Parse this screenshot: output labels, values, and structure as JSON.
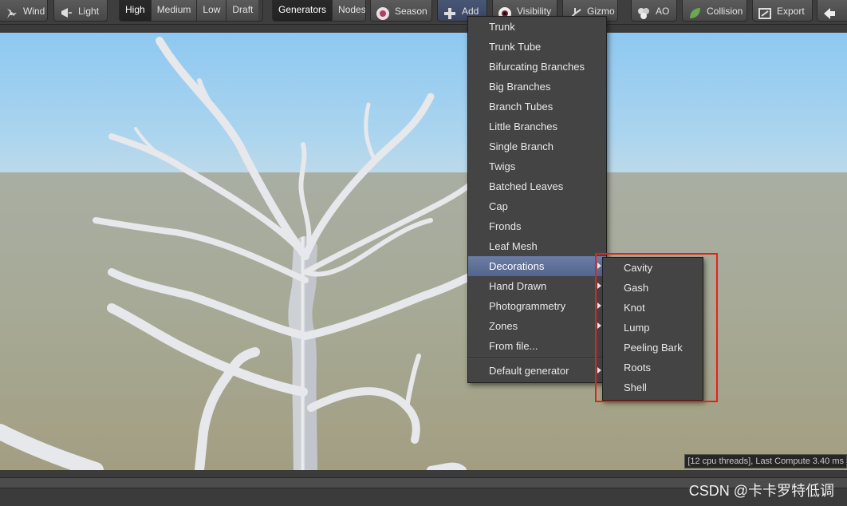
{
  "toolbar": {
    "wind": "Wind",
    "light": "Light",
    "quality": [
      "High",
      "Medium",
      "Low",
      "Draft"
    ],
    "quality_active": "High",
    "views": [
      "Generators",
      "Nodes"
    ],
    "views_active": "Generators",
    "season": "Season",
    "add": "Add",
    "visibility": "Visibility",
    "gizmo": "Gizmo",
    "ao": "AO",
    "collision": "Collision",
    "export": "Export"
  },
  "add_menu": {
    "items": [
      {
        "label": "Trunk"
      },
      {
        "label": "Trunk Tube"
      },
      {
        "label": "Bifurcating Branches"
      },
      {
        "label": "Big Branches"
      },
      {
        "label": "Branch Tubes"
      },
      {
        "label": "Little Branches"
      },
      {
        "label": "Single Branch"
      },
      {
        "label": "Twigs"
      },
      {
        "label": "Batched Leaves"
      },
      {
        "label": "Cap"
      },
      {
        "label": "Fronds"
      },
      {
        "label": "Leaf Mesh"
      },
      {
        "label": "Decorations",
        "submenu": true,
        "highlighted": true
      },
      {
        "label": "Hand Drawn",
        "submenu": true
      },
      {
        "label": "Photogrammetry",
        "submenu": true
      },
      {
        "label": "Zones",
        "submenu": true
      },
      {
        "label": "From file..."
      }
    ],
    "footer": "Default generator"
  },
  "decorations_menu": {
    "items": [
      "Cavity",
      "Gash",
      "Knot",
      "Lump",
      "Peeling Bark",
      "Roots",
      "Shell"
    ]
  },
  "status_text": "[12 cpu threads], Last Compute 3.40 ms",
  "watermark": "CSDN @卡卡罗特低调",
  "colors": {
    "highlight": "#5f72a0",
    "annotation_box": "#e0241d"
  }
}
